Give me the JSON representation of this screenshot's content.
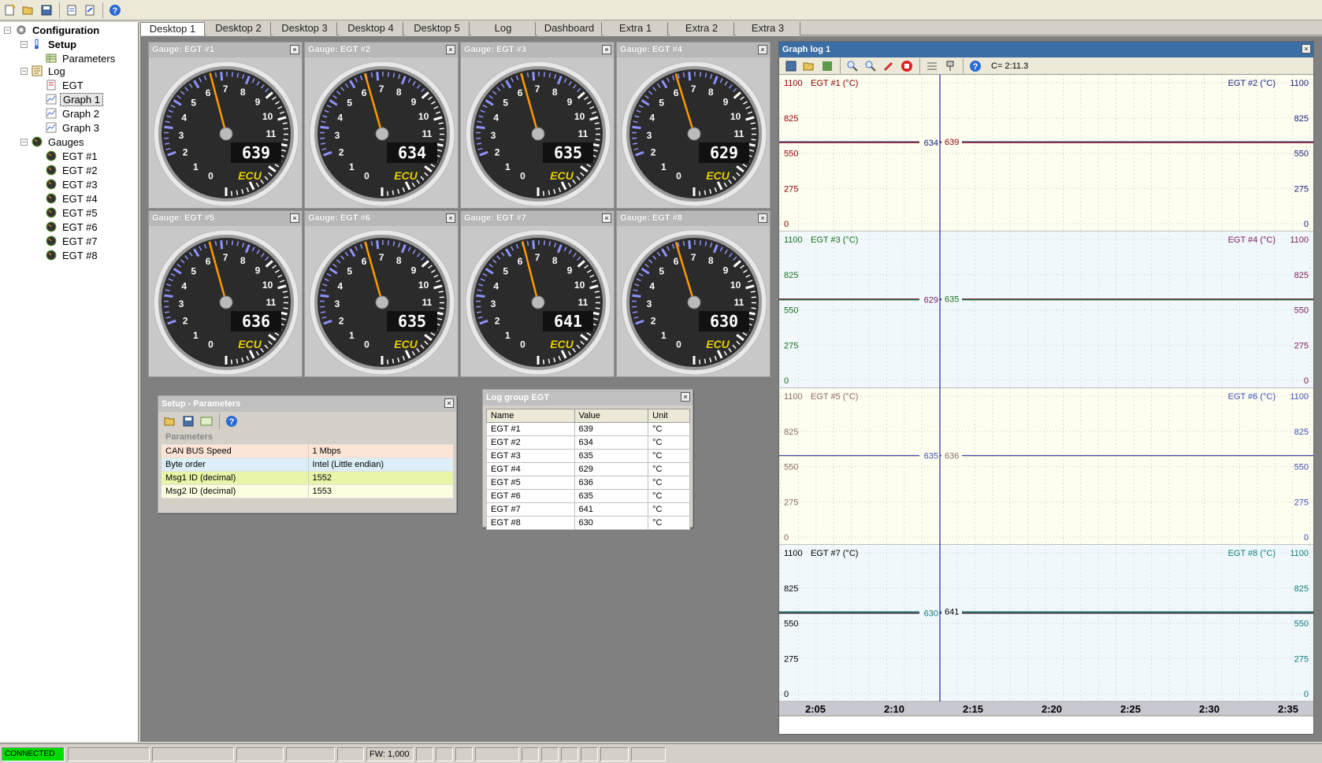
{
  "colors": {
    "accent": "#3a6ea5",
    "connected": "#00dc00",
    "needle": "#ff9900"
  },
  "toolbar": {
    "icons": [
      "new-icon",
      "open-icon",
      "save-icon",
      "open-config-icon",
      "export-icon",
      "help-icon"
    ]
  },
  "tree": {
    "root": "Configuration",
    "setup": "Setup",
    "parameters": "Parameters",
    "log": "Log",
    "log_items": [
      "EGT",
      "Graph 1",
      "Graph 2",
      "Graph 3"
    ],
    "gauges": "Gauges",
    "gauge_items": [
      "EGT #1",
      "EGT #2",
      "EGT #3",
      "EGT #4",
      "EGT #5",
      "EGT #6",
      "EGT #7",
      "EGT #8"
    ]
  },
  "tabs": [
    "Desktop 1",
    "Desktop 2",
    "Desktop 3",
    "Desktop 4",
    "Desktop 5",
    "Log",
    "Dashboard",
    "Extra 1",
    "Extra 2",
    "Extra 3"
  ],
  "gauges": [
    {
      "title": "Gauge: EGT #1",
      "value": "639"
    },
    {
      "title": "Gauge: EGT #2",
      "value": "634"
    },
    {
      "title": "Gauge: EGT #3",
      "value": "635"
    },
    {
      "title": "Gauge: EGT #4",
      "value": "629"
    },
    {
      "title": "Gauge: EGT #5",
      "value": "636"
    },
    {
      "title": "Gauge: EGT #6",
      "value": "635"
    },
    {
      "title": "Gauge: EGT #7",
      "value": "641"
    },
    {
      "title": "Gauge: EGT #8",
      "value": "630"
    }
  ],
  "gauge_scale": [
    "0",
    "1",
    "2",
    "3",
    "4",
    "5",
    "6",
    "7",
    "8",
    "9",
    "10",
    "11"
  ],
  "gauge_brand": "ECU",
  "params": {
    "title": "Setup - Parameters",
    "header": "Parameters",
    "rows": [
      {
        "name": "CAN BUS Speed",
        "value": "1 Mbps",
        "color": "#fce4d6"
      },
      {
        "name": "Byte order",
        "value": "Intel (Little endian)",
        "color": "#dceef8"
      },
      {
        "name": "Msg1 ID (decimal)",
        "value": "1552",
        "color": "#e8f4a8"
      },
      {
        "name": "Msg2 ID (decimal)",
        "value": "1553",
        "color": "#fdfde0"
      }
    ]
  },
  "loggroup": {
    "title": "Log group EGT",
    "columns": [
      "Name",
      "Value",
      "Unit"
    ],
    "rows": [
      [
        "EGT #1",
        "639",
        "°C"
      ],
      [
        "EGT #2",
        "634",
        "°C"
      ],
      [
        "EGT #3",
        "635",
        "°C"
      ],
      [
        "EGT #4",
        "629",
        "°C"
      ],
      [
        "EGT #5",
        "636",
        "°C"
      ],
      [
        "EGT #6",
        "635",
        "°C"
      ],
      [
        "EGT #7",
        "641",
        "°C"
      ],
      [
        "EGT #8",
        "630",
        "°C"
      ]
    ]
  },
  "graph": {
    "title": "Graph log 1",
    "cursor": "C= 2:11.3",
    "time_labels": [
      "2:05",
      "2:10",
      "2:15",
      "2:20",
      "2:25",
      "2:30",
      "2:35"
    ],
    "panes": [
      {
        "left": "EGT #1 (°C)",
        "right": "EGT #2 (°C)",
        "lcolor": "#8b0000",
        "rcolor": "#1a237e",
        "bg": "#fdfdf0",
        "a": 634,
        "b": 639
      },
      {
        "left": "EGT #3 (°C)",
        "right": "EGT #4 (°C)",
        "lcolor": "#1b6e1b",
        "rcolor": "#7a1f5a",
        "bg": "#f0f8fc",
        "a": 629,
        "b": 635
      },
      {
        "left": "EGT #5 (°C)",
        "right": "EGT #6 (°C)",
        "lcolor": "#8d6e63",
        "rcolor": "#3f51b5",
        "bg": "#fdfdf0",
        "a": 635,
        "b": 636
      },
      {
        "left": "EGT #7 (°C)",
        "right": "EGT #8 (°C)",
        "lcolor": "#000000",
        "rcolor": "#0e7c7b",
        "bg": "#f0f8fc",
        "a": 630,
        "b": 641
      }
    ],
    "scale": [
      "1100",
      "825",
      "550",
      "275",
      "0"
    ]
  },
  "status": {
    "connected": "CONNECTED",
    "fw": "FW: 1,000"
  }
}
